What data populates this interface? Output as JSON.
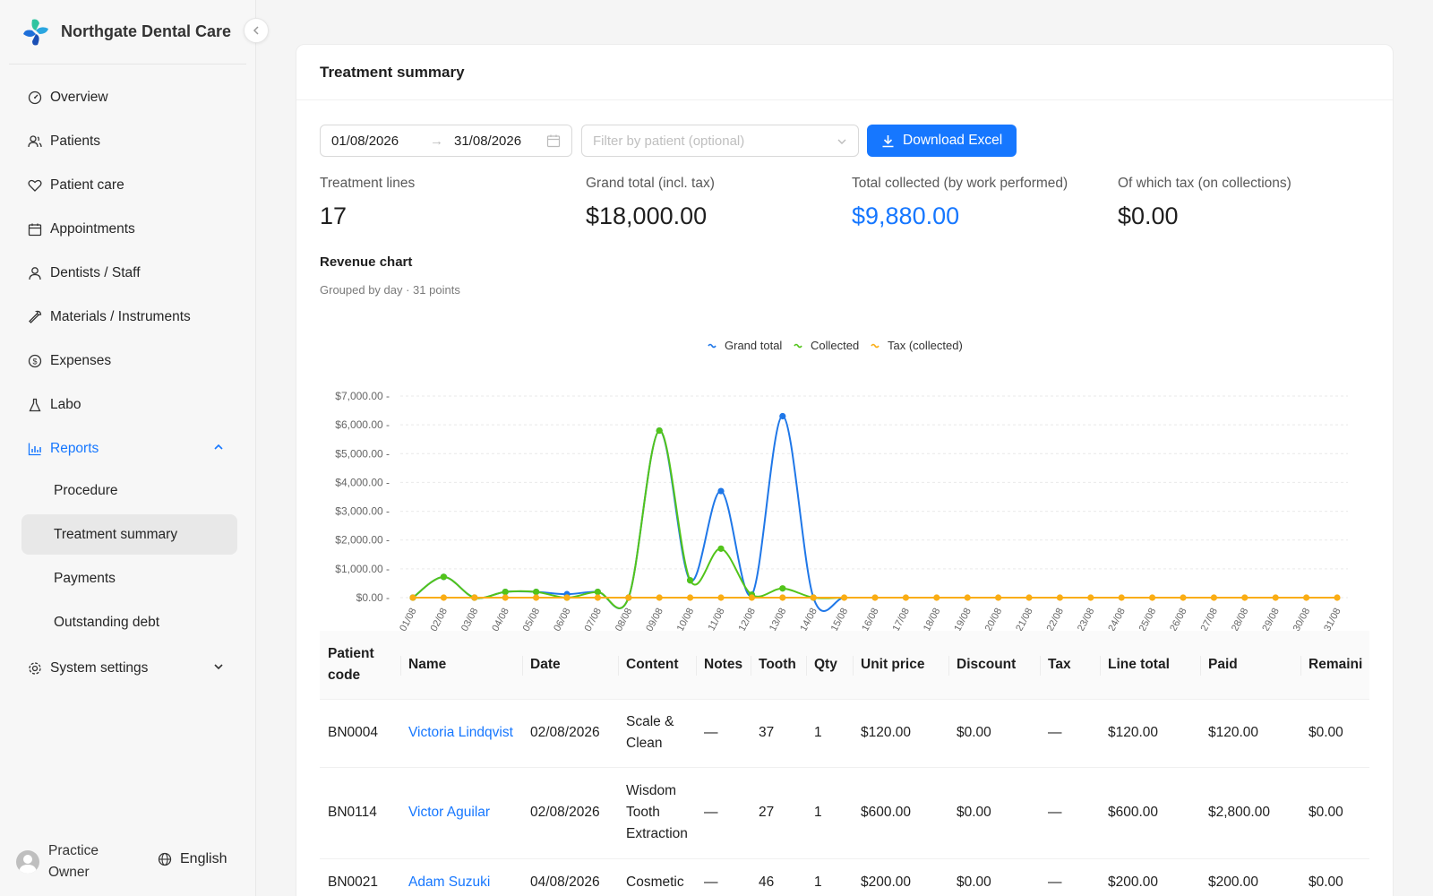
{
  "brand": {
    "name": "Northgate Dental Care"
  },
  "nav": {
    "items": [
      {
        "label": "Overview",
        "icon": "dashboard-icon"
      },
      {
        "label": "Patients",
        "icon": "users-icon"
      },
      {
        "label": "Patient care",
        "icon": "heart-icon"
      },
      {
        "label": "Appointments",
        "icon": "calendar-icon"
      },
      {
        "label": "Dentists / Staff",
        "icon": "user-icon"
      },
      {
        "label": "Materials / Instruments",
        "icon": "wrench-icon"
      },
      {
        "label": "Expenses",
        "icon": "dollar-circle-icon"
      },
      {
        "label": "Labo",
        "icon": "flask-icon"
      }
    ],
    "reports": {
      "label": "Reports",
      "sub": [
        "Procedure",
        "Treatment summary",
        "Payments",
        "Outstanding debt"
      ],
      "selected": "Treatment summary"
    },
    "settings": {
      "label": "System settings"
    }
  },
  "footer": {
    "user": "Practice Owner",
    "language": "English"
  },
  "page": {
    "title": "Treatment summary"
  },
  "filters": {
    "date_from": "01/08/2026",
    "date_to": "31/08/2026",
    "patient_placeholder": "Filter by patient (optional)",
    "download_label": "Download Excel"
  },
  "stats": [
    {
      "label": "Treatment lines",
      "value": "17",
      "highlight": false
    },
    {
      "label": "Grand total (incl. tax)",
      "value": "$18,000.00",
      "highlight": false
    },
    {
      "label": "Total collected (by work performed)",
      "value": "$9,880.00",
      "highlight": true
    },
    {
      "label": "Of which tax (on collections)",
      "value": "$0.00",
      "highlight": false
    }
  ],
  "chart": {
    "title": "Revenue chart",
    "subtitle": "Grouped by day · 31 points"
  },
  "chart_data": {
    "type": "line",
    "x": [
      "01/08",
      "02/08",
      "03/08",
      "04/08",
      "05/08",
      "06/08",
      "07/08",
      "08/08",
      "09/08",
      "10/08",
      "11/08",
      "12/08",
      "13/08",
      "14/08",
      "15/08",
      "16/08",
      "17/08",
      "18/08",
      "19/08",
      "20/08",
      "21/08",
      "22/08",
      "23/08",
      "24/08",
      "25/08",
      "26/08",
      "27/08",
      "28/08",
      "29/08",
      "30/08",
      "31/08"
    ],
    "ylim": [
      0,
      7000
    ],
    "yticks": [
      "$0.00",
      "$1,000.00",
      "$2,000.00",
      "$3,000.00",
      "$4,000.00",
      "$5,000.00",
      "$6,000.00",
      "$7,000.00"
    ],
    "legend_position": "top-center",
    "grid": "horizontal-dashed",
    "series": [
      {
        "name": "Grand total",
        "color": "#1f77e8",
        "values": [
          0,
          720,
          0,
          200,
          200,
          120,
          200,
          0,
          5800,
          600,
          3700,
          100,
          6300,
          0,
          0,
          0,
          0,
          0,
          0,
          0,
          0,
          0,
          0,
          0,
          0,
          0,
          0,
          0,
          0,
          0,
          0
        ]
      },
      {
        "name": "Collected",
        "color": "#52c41a",
        "values": [
          0,
          720,
          0,
          200,
          200,
          0,
          200,
          0,
          5800,
          600,
          1700,
          100,
          320,
          0,
          0,
          0,
          0,
          0,
          0,
          0,
          0,
          0,
          0,
          0,
          0,
          0,
          0,
          0,
          0,
          0,
          0
        ]
      },
      {
        "name": "Tax (collected)",
        "color": "#faad14",
        "values": [
          0,
          0,
          0,
          0,
          0,
          0,
          0,
          0,
          0,
          0,
          0,
          0,
          0,
          0,
          0,
          0,
          0,
          0,
          0,
          0,
          0,
          0,
          0,
          0,
          0,
          0,
          0,
          0,
          0,
          0,
          0
        ]
      }
    ]
  },
  "table": {
    "columns": [
      "Patient code",
      "Name",
      "Date",
      "Content",
      "Notes",
      "Tooth",
      "Qty",
      "Unit price",
      "Discount",
      "Tax",
      "Line total",
      "Paid",
      "Remaini"
    ],
    "rows": [
      [
        "BN0004",
        "Victoria Lindqvist",
        "02/08/2026",
        "Scale & Clean",
        "—",
        "37",
        "1",
        "$120.00",
        "$0.00",
        "—",
        "$120.00",
        "$120.00",
        "$0.00"
      ],
      [
        "BN0114",
        "Victor Aguilar",
        "02/08/2026",
        "Wisdom Tooth Extraction",
        "—",
        "27",
        "1",
        "$600.00",
        "$0.00",
        "—",
        "$600.00",
        "$2,800.00",
        "$0.00"
      ],
      [
        "BN0021",
        "Adam Suzuki",
        "04/08/2026",
        "Cosmetic",
        "—",
        "46",
        "1",
        "$200.00",
        "$0.00",
        "—",
        "$200.00",
        "$200.00",
        "$0.00"
      ]
    ]
  }
}
